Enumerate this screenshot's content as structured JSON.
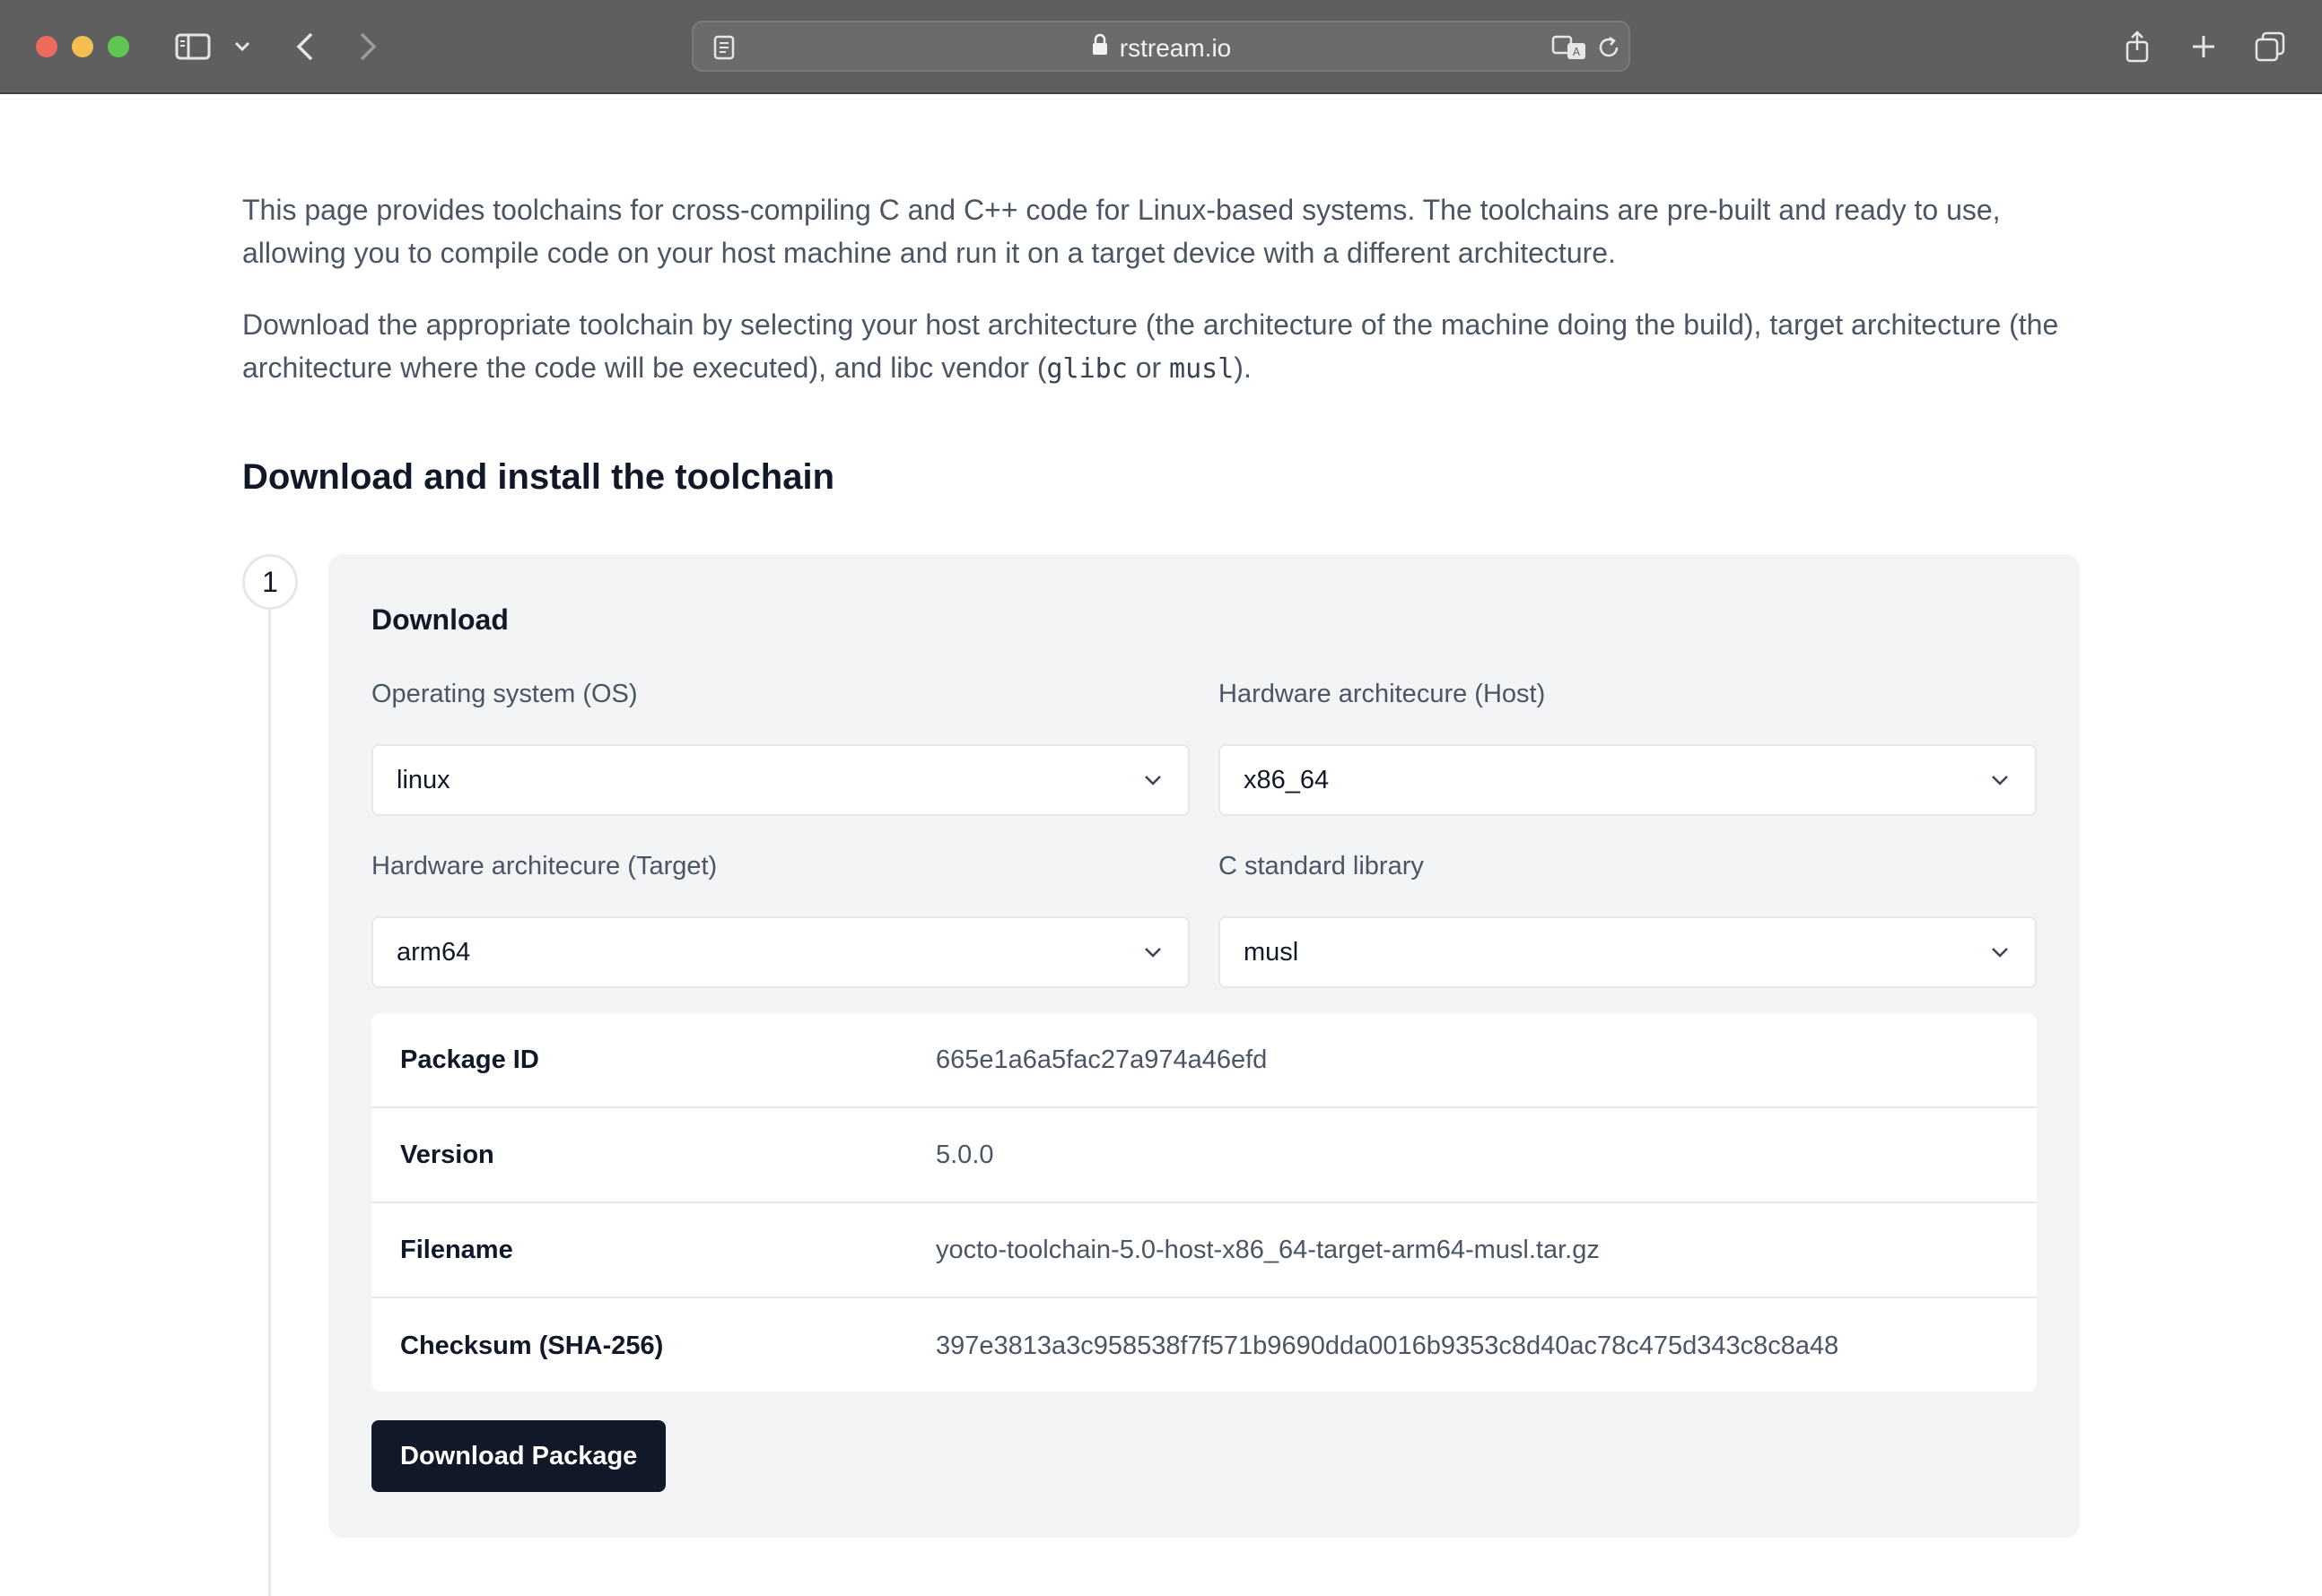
{
  "browser": {
    "url": "rstream.io"
  },
  "intro": {
    "p1": "This page provides toolchains for cross-compiling C and C++ code for Linux-based systems. The toolchains are pre-built and ready to use, allowing you to compile code on your host machine and run it on a target device with a different architecture.",
    "p2_before": "Download the appropriate toolchain by selecting your host architecture (the architecture of the machine doing the build), target architecture (the architecture where the code will be executed), and libc vendor (",
    "p2_code1": "glibc",
    "p2_mid": " or ",
    "p2_code2": "musl",
    "p2_after": ")."
  },
  "section": {
    "title": "Download and install the toolchain"
  },
  "step": {
    "number": "1",
    "title": "Download",
    "fields": {
      "os": {
        "label": "Operating system (OS)",
        "value": "linux"
      },
      "host": {
        "label": "Hardware architecure (Host)",
        "value": "x86_64"
      },
      "target": {
        "label": "Hardware architecure (Target)",
        "value": "arm64"
      },
      "libc": {
        "label": "C standard library",
        "value": "musl"
      }
    },
    "details": [
      {
        "key": "Package ID",
        "value": "665e1a6a5fac27a974a46efd"
      },
      {
        "key": "Version",
        "value": "5.0.0"
      },
      {
        "key": "Filename",
        "value": "yocto-toolchain-5.0-host-x86_64-target-arm64-musl.tar.gz"
      },
      {
        "key": "Checksum (SHA-256)",
        "value": "397e3813a3c958538f7f571b9690dda0016b9353c8d40ac78c475d343c8c8a48"
      }
    ],
    "download_label": "Download Package"
  }
}
